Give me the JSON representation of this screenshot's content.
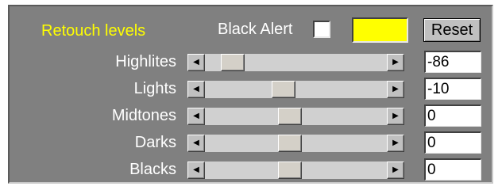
{
  "panel": {
    "title": "Retouch levels",
    "black_alert_label": "Black Alert",
    "black_alert_checked": false,
    "swatch_color": "#ffff00",
    "reset_label": "Reset"
  },
  "sliders": [
    {
      "label": "Highlites",
      "value": "-86",
      "level": 0.1
    },
    {
      "label": "Lights",
      "value": "-10",
      "level": 0.42
    },
    {
      "label": "Midtones",
      "value": "0",
      "level": 0.46
    },
    {
      "label": "Darks",
      "value": "0",
      "level": 0.46
    },
    {
      "label": "Blacks",
      "value": "0",
      "level": 0.46
    }
  ],
  "icons": {
    "scroll_left": "arrow-left-icon",
    "scroll_right": "arrow-right-icon"
  },
  "colors": {
    "panel_bg": "#808080",
    "title_color": "#ffff00",
    "label_color": "#ffffff"
  }
}
